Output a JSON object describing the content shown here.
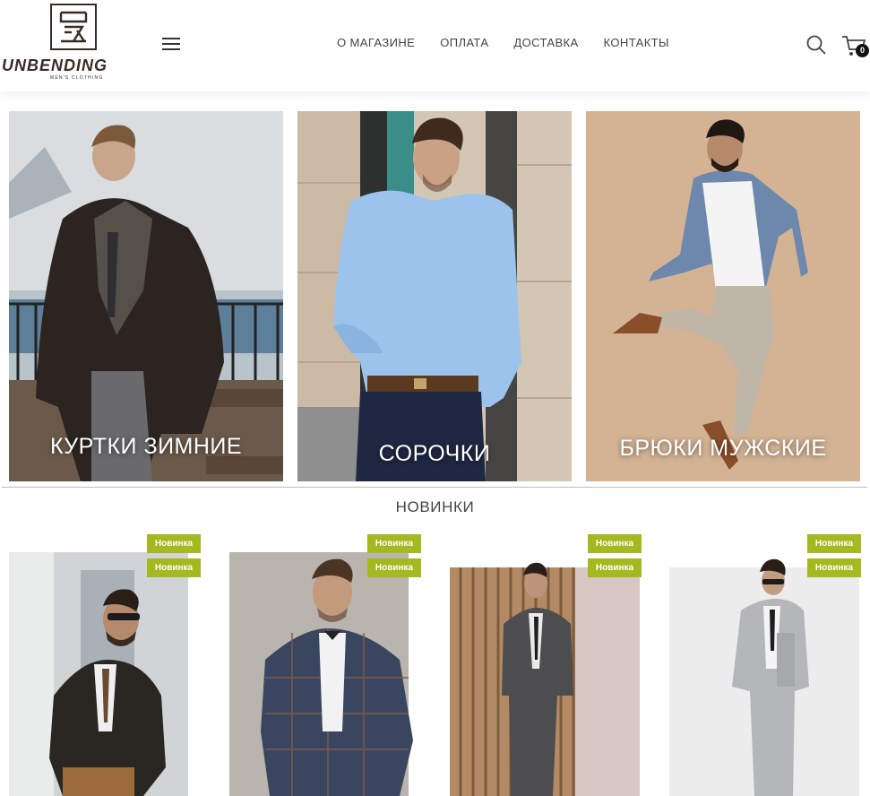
{
  "brand": {
    "name": "UNBENDING",
    "tagline": "MEN'S CLOTHING"
  },
  "nav": [
    "О МАГАЗИНЕ",
    "ОПЛАТА",
    "ДОСТАВКА",
    "КОНТАКТЫ"
  ],
  "cart": {
    "count": "0"
  },
  "categories": [
    {
      "label": "КУРТКИ ЗИМНИЕ"
    },
    {
      "label": "СОРОЧКИ"
    },
    {
      "label": "БРЮКИ МУЖСКИЕ"
    }
  ],
  "section_title": "НОВИНКИ",
  "products": [
    {
      "badges": [
        "Новинка",
        "Новинка"
      ]
    },
    {
      "badges": [
        "Новинка",
        "Новинка"
      ]
    },
    {
      "badges": [
        "Новинка",
        "Новинка"
      ]
    },
    {
      "badges": [
        "Новинка",
        "Новинка"
      ]
    }
  ],
  "colors": {
    "badge": "#a4b81f",
    "logo": "#3b2b26",
    "category_text": "#ffffff"
  }
}
